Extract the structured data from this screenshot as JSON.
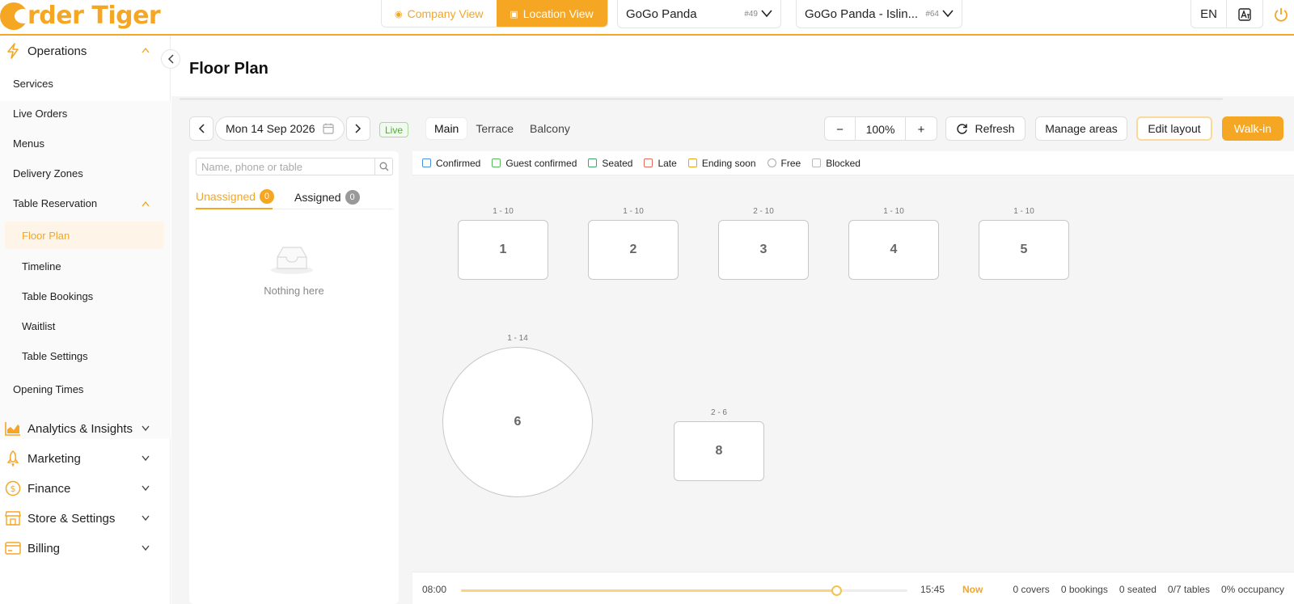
{
  "brand": {
    "logo_text": "rder Tiger",
    "accent": "#f5a623"
  },
  "topbar": {
    "company_view": "Company View",
    "location_view": "Location View",
    "company_select": {
      "value": "GoGo Panda",
      "num": "#49"
    },
    "location_select": {
      "value": "GoGo Panda - Islin...",
      "num": "#64"
    },
    "language": "EN"
  },
  "sidebar": {
    "groups": [
      {
        "label": "Operations",
        "icon": "bolt-icon",
        "expanded": true
      },
      {
        "label": "Analytics & Insights",
        "icon": "chart-icon"
      },
      {
        "label": "Marketing",
        "icon": "rocket-icon"
      },
      {
        "label": "Finance",
        "icon": "dollar-icon"
      },
      {
        "label": "Store & Settings",
        "icon": "store-icon"
      },
      {
        "label": "Billing",
        "icon": "card-icon"
      }
    ],
    "items": {
      "services": "Services",
      "live_orders": "Live Orders",
      "menus": "Menus",
      "delivery_zones": "Delivery Zones",
      "table_reservation": "Table Reservation",
      "floor_plan": "Floor Plan",
      "timeline": "Timeline",
      "table_bookings": "Table Bookings",
      "waitlist": "Waitlist",
      "table_settings": "Table Settings",
      "opening_times": "Opening Times"
    }
  },
  "page": {
    "title": "Floor Plan",
    "date": "Mon 14 Sep 2026",
    "live": "Live",
    "area_tabs": [
      "Main",
      "Terrace",
      "Balcony"
    ],
    "active_area": "Main",
    "zoom_minus": "−",
    "zoom_value": "100%",
    "zoom_plus": "+",
    "refresh": "Refresh",
    "manage_areas": "Manage areas",
    "edit_layout": "Edit layout",
    "walk_in": "Walk-in"
  },
  "left_panel": {
    "search_placeholder": "Name, phone or table",
    "tab_unassigned": "Unassigned",
    "unassigned_count": "0",
    "tab_assigned": "Assigned",
    "assigned_count": "0",
    "empty_text": "Nothing here"
  },
  "legend": [
    {
      "label": "Confirmed",
      "color": "#4a90d9"
    },
    {
      "label": "Guest confirmed",
      "color": "#5cb85c"
    },
    {
      "label": "Seated",
      "color": "#3aa86b"
    },
    {
      "label": "Late",
      "color": "#e26d5a"
    },
    {
      "label": "Ending soon",
      "color": "#e6a817"
    },
    {
      "label": "Free",
      "color": "#aaaaaa"
    },
    {
      "label": "Blocked",
      "color": "#bbbbbb"
    }
  ],
  "tables": [
    {
      "number": "1",
      "capacity": "1 - 10",
      "shape": "rect"
    },
    {
      "number": "2",
      "capacity": "1 - 10",
      "shape": "rect"
    },
    {
      "number": "3",
      "capacity": "2 - 10",
      "shape": "rect"
    },
    {
      "number": "4",
      "capacity": "1 - 10",
      "shape": "rect"
    },
    {
      "number": "5",
      "capacity": "1 - 10",
      "shape": "rect"
    },
    {
      "number": "6",
      "capacity": "1 - 14",
      "shape": "round"
    },
    {
      "number": "8",
      "capacity": "2 - 6",
      "shape": "rect"
    }
  ],
  "timeline": {
    "start": "08:00",
    "end": "15:45",
    "now": "Now",
    "progress": 0.84,
    "covers": "0 covers",
    "bookings": "0 bookings",
    "seated": "0 seated",
    "tables": "0/7 tables",
    "occupancy": "0% occupancy"
  }
}
